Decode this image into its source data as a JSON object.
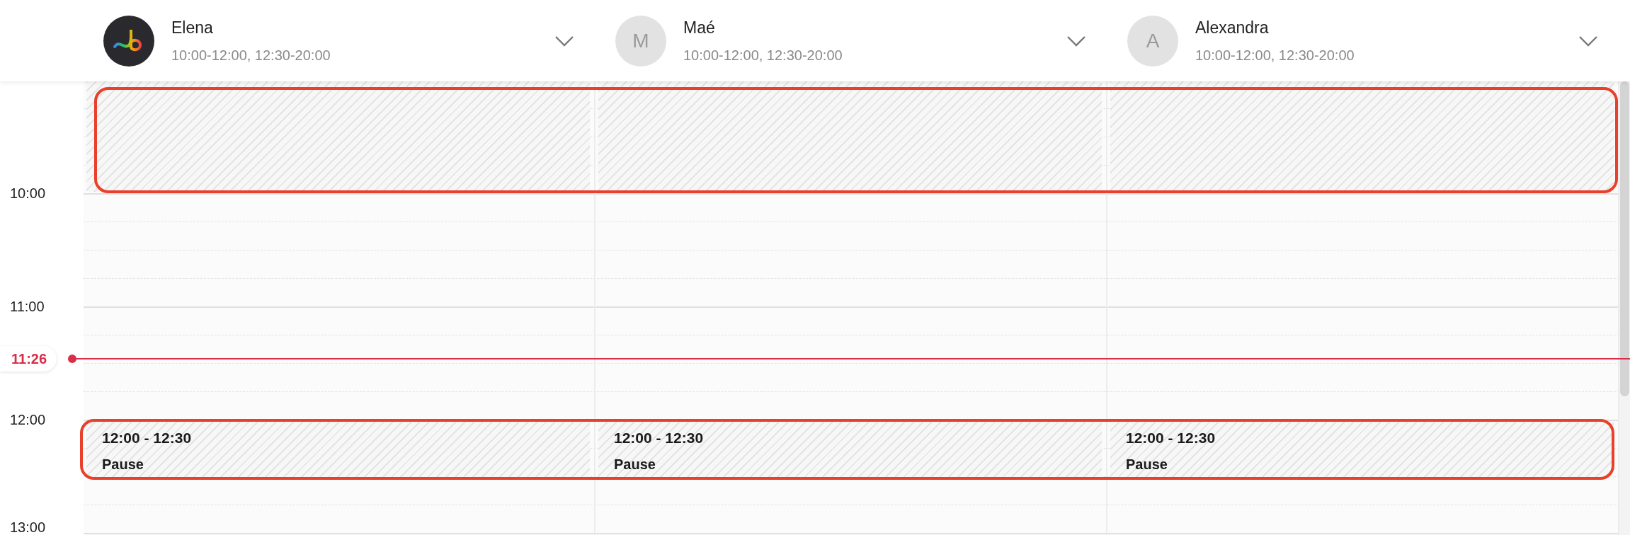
{
  "staff": [
    {
      "name": "Elena",
      "hours": "10:00-12:00, 12:30-20:00",
      "avatar": {
        "kind": "logo"
      },
      "blocks": [
        {
          "kind": "unavailable"
        },
        {
          "kind": "pause",
          "time": "12:00 - 12:30",
          "label": "Pause"
        }
      ]
    },
    {
      "name": "Maé",
      "hours": "10:00-12:00, 12:30-20:00",
      "avatar": {
        "kind": "initial",
        "text": "M"
      },
      "blocks": [
        {
          "kind": "unavailable"
        },
        {
          "kind": "pause",
          "time": "12:00 - 12:30",
          "label": "Pause"
        }
      ]
    },
    {
      "name": "Alexandra",
      "hours": "10:00-12:00, 12:30-20:00",
      "avatar": {
        "kind": "initial",
        "text": "A"
      },
      "blocks": [
        {
          "kind": "unavailable"
        },
        {
          "kind": "pause",
          "time": "12:00 - 12:30",
          "label": "Pause"
        }
      ]
    }
  ],
  "time_labels": [
    "10:00",
    "11:00",
    "12:00",
    "13:00"
  ],
  "now_marker": {
    "time": "11:26"
  }
}
